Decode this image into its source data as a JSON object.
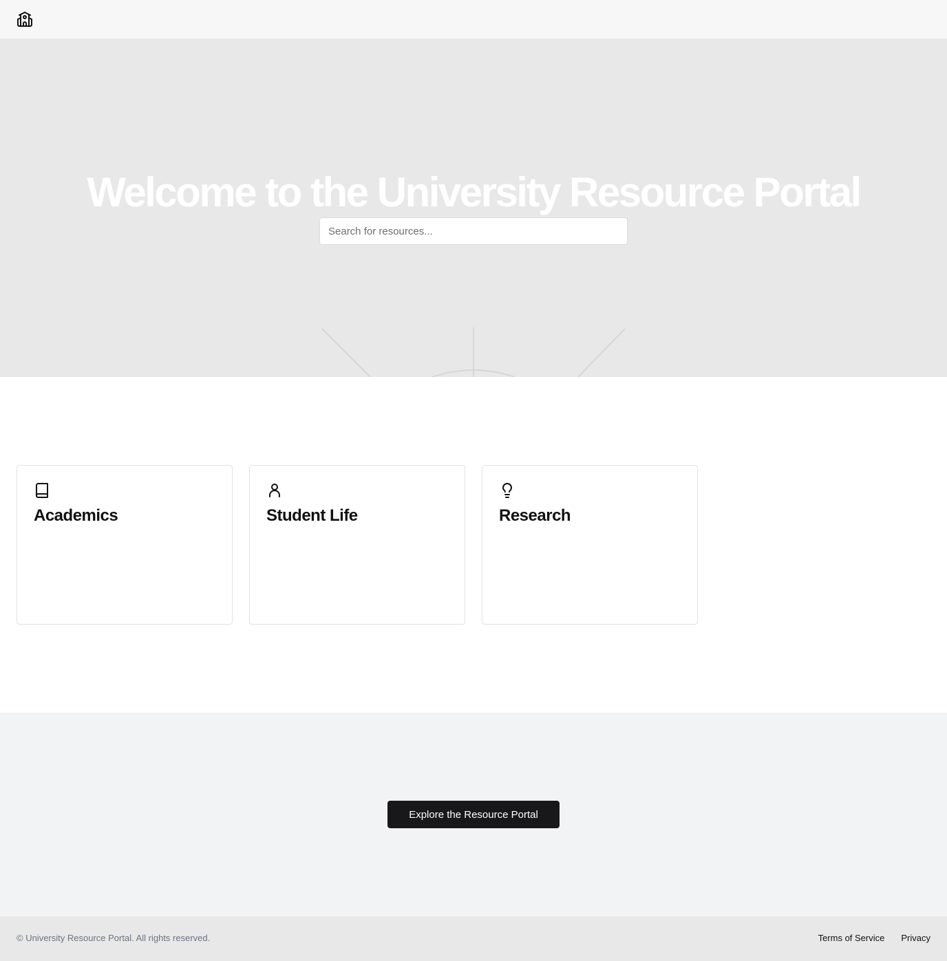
{
  "header": {
    "logo_icon": "university-building-icon"
  },
  "hero": {
    "title": "Welcome to the University Resource Portal",
    "search": {
      "placeholder": "Search for resources...",
      "value": ""
    },
    "background_color": "#e8e8e8"
  },
  "cards": [
    {
      "title": "Academics",
      "icon": "book-icon"
    },
    {
      "title": "Student Life",
      "icon": "user-icon"
    },
    {
      "title": "Research",
      "icon": "lightbulb-icon"
    }
  ],
  "cta": {
    "button_label": "Explore the Resource Portal",
    "button_color": "#18181a"
  },
  "footer": {
    "copyright": "© University Resource Portal. All rights reserved.",
    "links": [
      "Terms of Service",
      "Privacy"
    ]
  }
}
